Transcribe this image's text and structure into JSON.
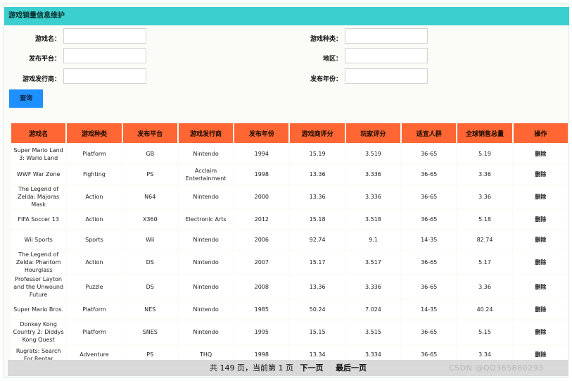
{
  "panel": {
    "title": "游戏销量信息维护"
  },
  "form": {
    "game_name": {
      "label": "游戏名：",
      "value": ""
    },
    "game_type": {
      "label": "游戏种类：",
      "value": ""
    },
    "platform": {
      "label": "发布平台：",
      "value": ""
    },
    "region": {
      "label": "地区：",
      "value": ""
    },
    "publisher": {
      "label": "游戏发行商：",
      "value": ""
    },
    "year": {
      "label": "发布年份：",
      "value": ""
    },
    "query_label": "查询"
  },
  "table": {
    "headers": [
      "游戏名",
      "游戏种类",
      "发布平台",
      "游戏发行商",
      "发布年份",
      "游戏商评分",
      "玩家评分",
      "适宜人群",
      "全球销售总量",
      "操作"
    ],
    "rows": [
      [
        "Super Mario Land 3: Wario Land",
        "Platform",
        "GB",
        "Nintendo",
        "1994",
        "15.19",
        "3.519",
        "36-65",
        "5.19",
        "删除"
      ],
      [
        "WWF War Zone",
        "Fighting",
        "PS",
        "Acclaim Entertainment",
        "1998",
        "13.36",
        "3.336",
        "36-65",
        "3.36",
        "删除"
      ],
      [
        "The Legend of Zelda: Majoras Mask",
        "Action",
        "N64",
        "Nintendo",
        "2000",
        "13.36",
        "3.336",
        "36-65",
        "3.36",
        "删除"
      ],
      [
        "FIFA Soccer 13",
        "Action",
        "X360",
        "Electronic Arts",
        "2012",
        "15.18",
        "3.518",
        "36-65",
        "5.18",
        "删除"
      ],
      [
        "Wii Sports",
        "Sports",
        "Wii",
        "Nintendo",
        "2006",
        "92.74",
        "9.1",
        "14-35",
        "82.74",
        "删除"
      ],
      [
        "The Legend of Zelda: Phantom Hourglass",
        "Action",
        "DS",
        "Nintendo",
        "2007",
        "15.17",
        "3.517",
        "36-65",
        "5.17",
        "删除"
      ],
      [
        "Professor Layton and the Unwound Future",
        "Puzzle",
        "DS",
        "Nintendo",
        "2008",
        "13.36",
        "3.336",
        "36-65",
        "3.36",
        "删除"
      ],
      [
        "Super Mario Bros.",
        "Platform",
        "NES",
        "Nintendo",
        "1985",
        "50.24",
        "7.024",
        "14-35",
        "40.24",
        "删除"
      ],
      [
        "Donkey Kong Country 2: Diddys Kong Quest",
        "Platform",
        "SNES",
        "Nintendo",
        "1995",
        "15.15",
        "3.515",
        "36-65",
        "5.15",
        "删除"
      ],
      [
        "Rugrats: Search For Reptar",
        "Adventure",
        "PS",
        "THQ",
        "1998",
        "13.34",
        "3.334",
        "36-65",
        "3.34",
        "删除"
      ]
    ]
  },
  "pager": {
    "info": "共 149 页，当前第 1 页",
    "next": "下一页",
    "last": "最后一页"
  },
  "watermark": "CSDN @QQ365880293"
}
